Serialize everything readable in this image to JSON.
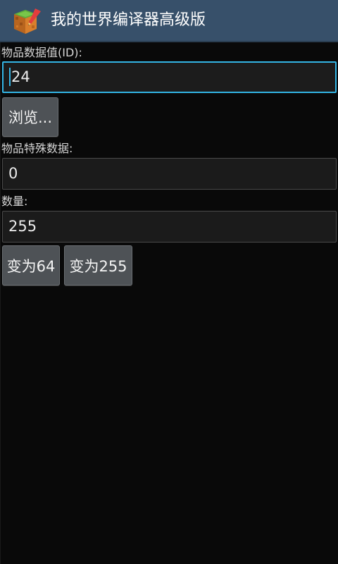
{
  "header": {
    "title": "我的世界编译器高级版",
    "icon": "minecraft-block-icon"
  },
  "form": {
    "item_id_label": "物品数据值(ID):",
    "item_id_value": "24",
    "browse_label": "浏览...",
    "special_data_label": "物品特殊数据:",
    "special_data_value": "0",
    "quantity_label": "数量:",
    "quantity_value": "255",
    "set64_label": "变为64",
    "set255_label": "变为255"
  },
  "colors": {
    "titlebar": "#37506a",
    "background": "#090909",
    "focus_accent": "#33b5e5",
    "button": "#4e5256"
  }
}
